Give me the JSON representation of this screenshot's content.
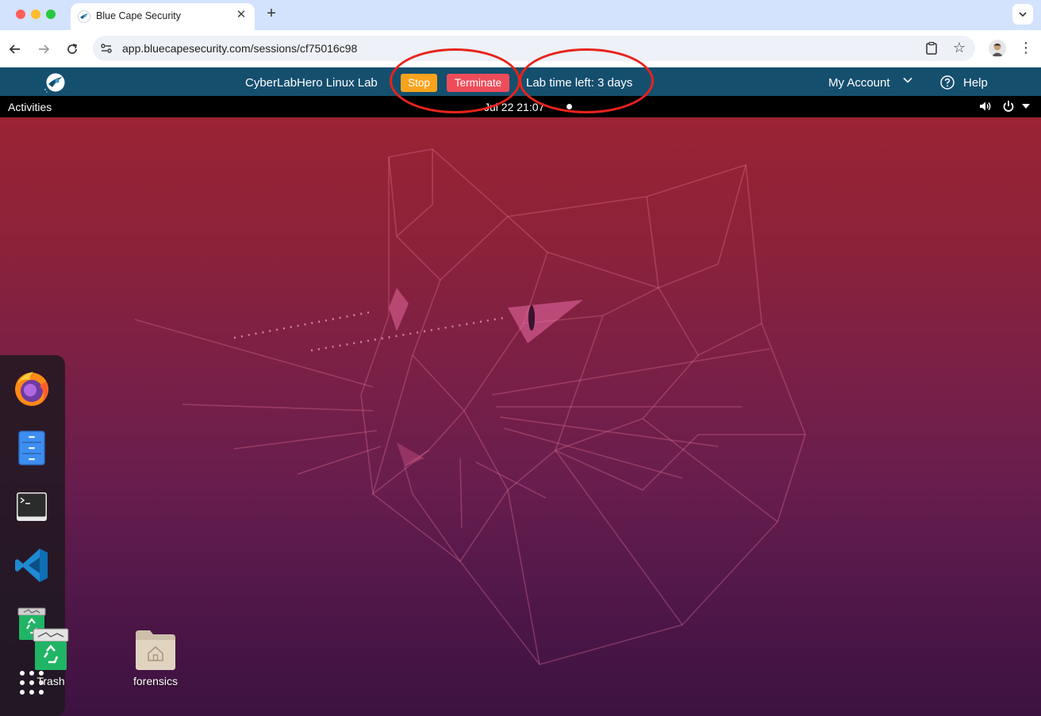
{
  "browser": {
    "tab_title": "Blue Cape Security",
    "new_tab_symbol": "+",
    "close_symbol": "✕",
    "url": "app.bluecapesecurity.com/sessions/cf75016c98"
  },
  "appbar": {
    "lab_title": "CyberLabHero Linux Lab",
    "stop_label": "Stop",
    "terminate_label": "Terminate",
    "time_left": "Lab time left: 3 days",
    "account_label": "My Account",
    "help_label": "Help"
  },
  "gnome": {
    "activities_label": "Activities",
    "clock": "Jul 22  21:07"
  },
  "dock": {
    "items": [
      "firefox-icon",
      "files-icon",
      "terminal-icon",
      "vscode-icon",
      "trash-icon",
      "show-apps-icon"
    ]
  },
  "desktop": {
    "icons": [
      {
        "label": "Trash",
        "icon": "trash-icon"
      },
      {
        "label": "forensics",
        "icon": "home-folder-icon"
      }
    ]
  },
  "colors": {
    "appbar": "#154f6e",
    "stop": "#f7a31c",
    "terminate": "#ef4c5a",
    "callout": "#e8231b"
  }
}
